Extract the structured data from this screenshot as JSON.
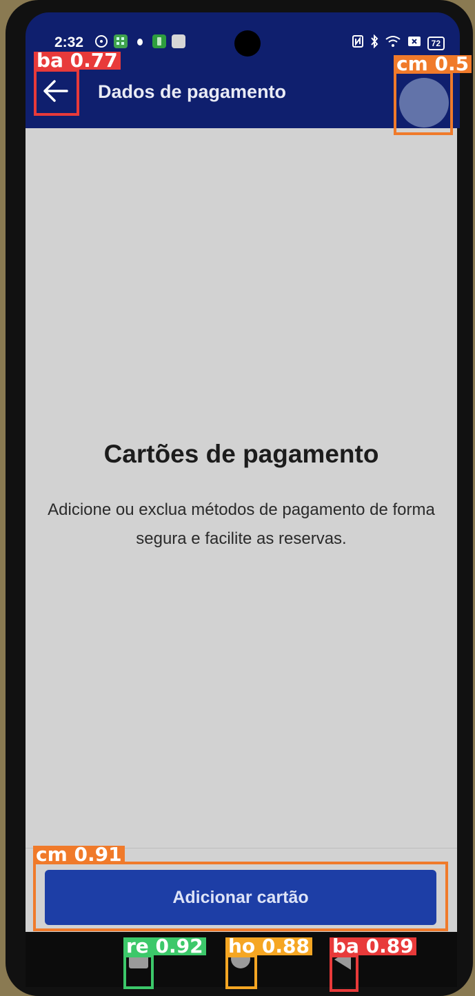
{
  "status_bar": {
    "time": "2:32",
    "battery": "72",
    "icons": [
      "steering-icon",
      "app-grid-icon",
      "bug-icon",
      "app-green-icon",
      "app-gray-icon"
    ],
    "right_icons": [
      "nfc-icon",
      "bluetooth-icon",
      "wifi-icon",
      "sim-icon",
      "battery-icon"
    ]
  },
  "app_bar": {
    "title": "Dados de pagamento",
    "back_icon": "arrow-left-icon",
    "color": "#0f1f6e"
  },
  "content": {
    "heading": "Cartões de pagamento",
    "description": "Adicione ou exclua métodos de pagamento de forma segura e facilite as reservas."
  },
  "actions": {
    "add_card_label": "Adicionar cartão",
    "button_color": "#1d3ea6"
  },
  "system_nav": {
    "buttons": [
      "recent-apps",
      "home",
      "back"
    ]
  },
  "detections": {
    "back_top": "ba 0.77",
    "avatar": "cm 0.5",
    "add_button": "cm 0.91",
    "recent": "re 0.92",
    "home": "ho 0.88",
    "back_nav": "ba 0.89"
  }
}
